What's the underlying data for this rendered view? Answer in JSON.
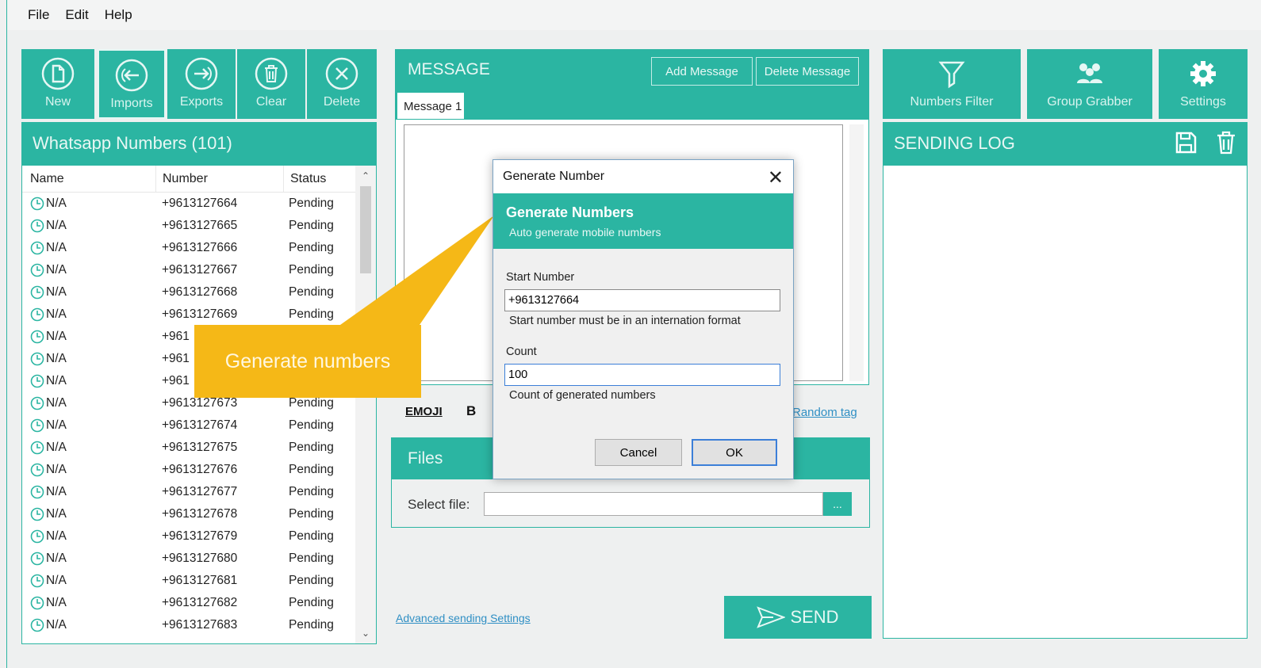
{
  "menu": {
    "file": "File",
    "edit": "Edit",
    "help": "Help"
  },
  "toolbar": {
    "new": "New",
    "imports": "Imports",
    "exports": "Exports",
    "clear": "Clear",
    "delete": "Delete"
  },
  "right_toolbar": {
    "numbers_filter": "Numbers Filter",
    "group_grabber": "Group Grabber",
    "settings": "Settings"
  },
  "numbers_panel": {
    "title": "Whatsapp Numbers (101)",
    "columns": [
      "Name",
      "Number",
      "Status"
    ],
    "rows": [
      {
        "name": "N/A",
        "number": "+9613127664",
        "status": "Pending"
      },
      {
        "name": "N/A",
        "number": "+9613127665",
        "status": "Pending"
      },
      {
        "name": "N/A",
        "number": "+9613127666",
        "status": "Pending"
      },
      {
        "name": "N/A",
        "number": "+9613127667",
        "status": "Pending"
      },
      {
        "name": "N/A",
        "number": "+9613127668",
        "status": "Pending"
      },
      {
        "name": "N/A",
        "number": "+9613127669",
        "status": "Pending"
      },
      {
        "name": "N/A",
        "number": "+961",
        "status": ""
      },
      {
        "name": "N/A",
        "number": "+961",
        "status": ""
      },
      {
        "name": "N/A",
        "number": "+961",
        "status": ""
      },
      {
        "name": "N/A",
        "number": "+9613127673",
        "status": "Pending"
      },
      {
        "name": "N/A",
        "number": "+9613127674",
        "status": "Pending"
      },
      {
        "name": "N/A",
        "number": "+9613127675",
        "status": "Pending"
      },
      {
        "name": "N/A",
        "number": "+9613127676",
        "status": "Pending"
      },
      {
        "name": "N/A",
        "number": "+9613127677",
        "status": "Pending"
      },
      {
        "name": "N/A",
        "number": "+9613127678",
        "status": "Pending"
      },
      {
        "name": "N/A",
        "number": "+9613127679",
        "status": "Pending"
      },
      {
        "name": "N/A",
        "number": "+9613127680",
        "status": "Pending"
      },
      {
        "name": "N/A",
        "number": "+9613127681",
        "status": "Pending"
      },
      {
        "name": "N/A",
        "number": "+9613127682",
        "status": "Pending"
      },
      {
        "name": "N/A",
        "number": "+9613127683",
        "status": "Pending"
      }
    ]
  },
  "message": {
    "title": "MESSAGE",
    "add_button": "Add Message",
    "delete_button": "Delete Message",
    "tab": "Message 1",
    "emoji": "EMOJI",
    "bold": "B",
    "random_tag": "Random tag"
  },
  "files": {
    "title": "Files",
    "select_label": "Select file:",
    "browse": "..."
  },
  "advanced_link": "Advanced sending Settings",
  "send_label": "SEND",
  "sending_log": {
    "title": "SENDING LOG"
  },
  "callout": "Generate numbers",
  "dialog": {
    "title": "Generate Number",
    "banner_title": "Generate Numbers",
    "banner_subtitle": "Auto generate mobile numbers",
    "start_label": "Start Number",
    "start_value": "+9613127664",
    "start_hint": "Start number must be in an internation format",
    "count_label": "Count",
    "count_value": "100",
    "count_hint": "Count of generated numbers",
    "cancel": "Cancel",
    "ok": "OK"
  },
  "colors": {
    "accent": "#2bb5a2",
    "callout": "#f5b817"
  }
}
